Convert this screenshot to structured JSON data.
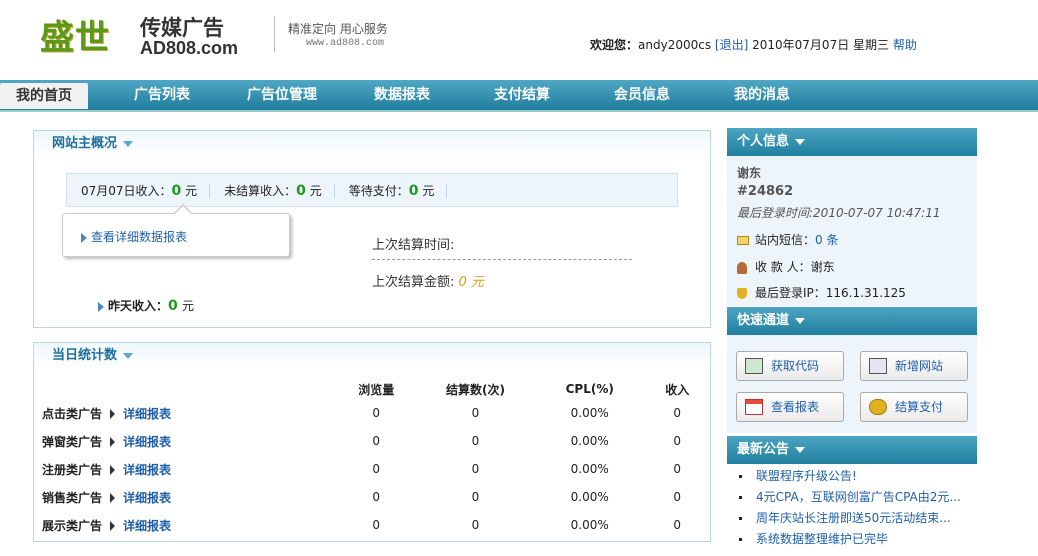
{
  "header": {
    "logo_cn": "盛世",
    "logo_cn2": "传媒广告",
    "logo_en": "AD808.com",
    "slogan": "精准定向  用心服务",
    "slogan_url": "www.ad808.com",
    "welcome_label": "欢迎您：",
    "username": "andy2000cs",
    "logout": "[退出]",
    "date": "2010年07月07日 星期三",
    "help": "帮助"
  },
  "nav": {
    "items": [
      "我的首页",
      "广告列表",
      "广告位管理",
      "数据报表",
      "支付结算",
      "会员信息",
      "我的消息"
    ]
  },
  "overview": {
    "title": "网站主概况",
    "today_label": "07月07日收入：",
    "today_value": "0",
    "unsettled_label": "未结算收入：",
    "unsettled_value": "0",
    "pending_label": "等待支付：",
    "pending_value": "0",
    "unit": "元",
    "detail_link": "查看详细数据报表",
    "last_settle_time_label": "上次结算时间:",
    "last_settle_amount_label": "上次结算金额:",
    "last_settle_amount_value": "0 元",
    "yesterday_label": "昨天收入：",
    "yesterday_value": "0"
  },
  "daily": {
    "title": "当日统计数",
    "headers": [
      "",
      "浏览量",
      "结算数(次)",
      "CPL(%)",
      "收入"
    ],
    "detail_label": "详细报表",
    "rows": [
      {
        "name": "点击类广告",
        "views": "0",
        "settle": "0",
        "cpl": "0.00%",
        "income": "0"
      },
      {
        "name": "弹窗类广告",
        "views": "0",
        "settle": "0",
        "cpl": "0.00%",
        "income": "0"
      },
      {
        "name": "注册类广告",
        "views": "0",
        "settle": "0",
        "cpl": "0.00%",
        "income": "0"
      },
      {
        "name": "销售类广告",
        "views": "0",
        "settle": "0",
        "cpl": "0.00%",
        "income": "0"
      },
      {
        "name": "展示类广告",
        "views": "0",
        "settle": "0",
        "cpl": "0.00%",
        "income": "0"
      }
    ]
  },
  "personal": {
    "title": "个人信息",
    "name": "谢东",
    "id": "#24862",
    "last_login": "最后登录时间:2010-07-07 10:47:11",
    "msg_label": "站内短信：",
    "msg_count": "0 条",
    "payee_label": "收 款 人：",
    "payee": "谢东",
    "ip_label": "最后登录IP：",
    "ip": "116.1.31.125"
  },
  "quick": {
    "title": "快速通道",
    "buttons": [
      "获取代码",
      "新增网站",
      "查看报表",
      "结算支付"
    ]
  },
  "notice": {
    "title": "最新公告",
    "items": [
      "联盟程序升级公告!",
      "4元CPA，互联网创富广告CPA由2元...",
      "周年庆站长注册即送50元活动结束...",
      "系统数据整理维护已完毕"
    ]
  }
}
